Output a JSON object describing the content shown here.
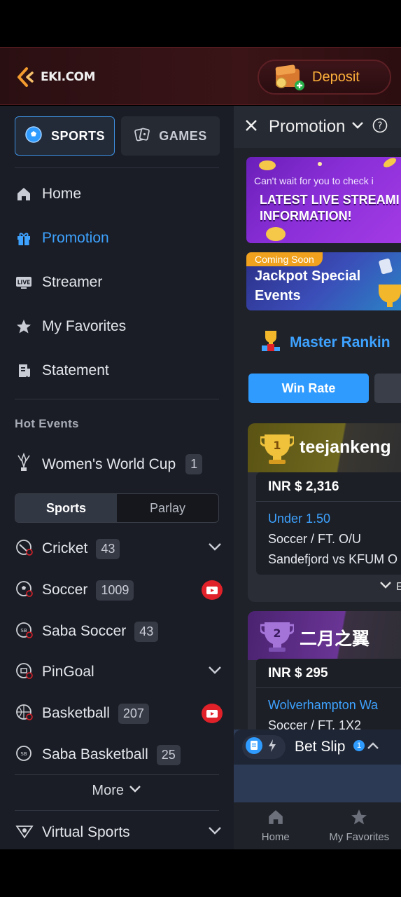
{
  "header": {
    "logo_text": "EKI.COM",
    "deposit_label": "Deposit"
  },
  "sidebar": {
    "tabs": [
      {
        "label": "SPORTS",
        "icon": "soccer-ball-icon",
        "active": true
      },
      {
        "label": "GAMES",
        "icon": "cards-icon",
        "active": false
      }
    ],
    "nav": [
      {
        "label": "Home",
        "icon": "home-icon"
      },
      {
        "label": "Promotion",
        "icon": "gift-icon",
        "active": true
      },
      {
        "label": "Streamer",
        "icon": "live-tv-icon"
      },
      {
        "label": "My Favorites",
        "icon": "star-icon"
      },
      {
        "label": "Statement",
        "icon": "receipt-icon"
      }
    ],
    "hot_events_title": "Hot Events",
    "hot_event": {
      "label": "Women's World Cup",
      "count": "1"
    },
    "segment": {
      "on": "Sports",
      "off": "Parlay"
    },
    "sports": [
      {
        "label": "Cricket",
        "count": "43",
        "right": "chevron"
      },
      {
        "label": "Soccer",
        "count": "1009",
        "right": "live"
      },
      {
        "label": "Saba Soccer",
        "count": "43",
        "right": ""
      },
      {
        "label": "PinGoal",
        "count": "",
        "right": "chevron"
      },
      {
        "label": "Basketball",
        "count": "207",
        "right": "live"
      },
      {
        "label": "Saba Basketball",
        "count": "25",
        "right": ""
      }
    ],
    "more_label": "More",
    "virtual_sports": "Virtual Sports"
  },
  "panel": {
    "title": "Promotion",
    "banner1": {
      "top": "Can't wait for you to check i",
      "line1": "LATEST LIVE STREAMI",
      "line2": "INFORMATION!"
    },
    "banner2": {
      "badge": "Coming Soon",
      "line1": "Jackpot Special",
      "line2": "Events"
    },
    "ranking_label": "Master Rankin",
    "win_rate": "Win Rate",
    "cards": [
      {
        "rank": "1",
        "name": "teejankeng",
        "amount": "INR $ 2,316",
        "pick": "Under 1.50",
        "market": "Soccer / FT. O/U",
        "match": "Sandefjord vs KFUM O",
        "more": "E"
      },
      {
        "rank": "2",
        "name": "二月之翼",
        "amount": "INR $ 295",
        "pick": "Wolverhampton Wa",
        "market": "Soccer / FT. 1X2"
      }
    ],
    "betslip": {
      "label": "Bet Slip",
      "count": "1"
    },
    "bottom_nav": [
      {
        "label": "Home",
        "icon": "home-icon"
      },
      {
        "label": "My Favorites",
        "icon": "star-icon"
      }
    ]
  },
  "colors": {
    "accent": "#3ea2ff",
    "deposit": "#ffb13b",
    "live": "#e0212a",
    "coming_soon": "#f0a21e"
  }
}
